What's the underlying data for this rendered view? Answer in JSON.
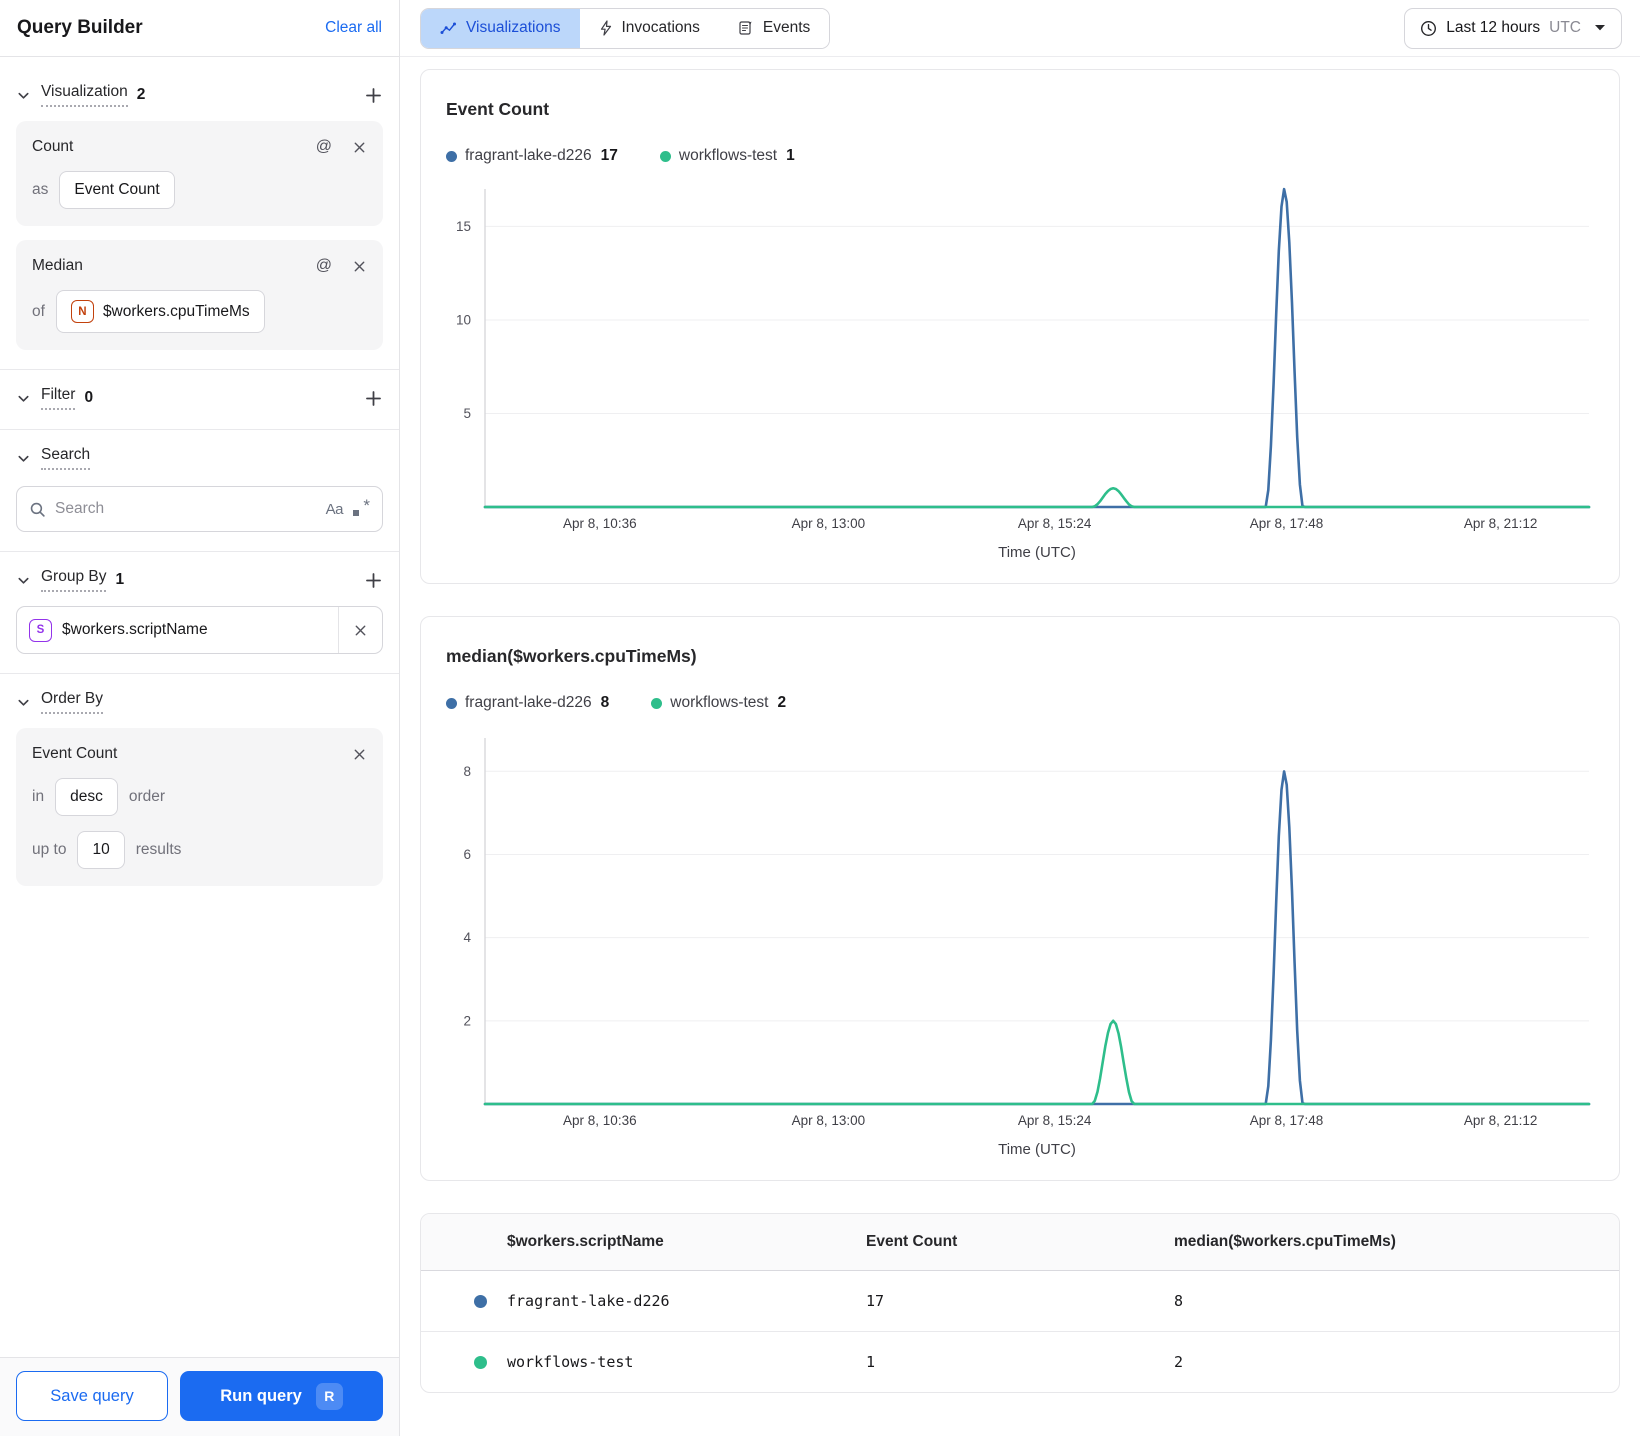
{
  "sidebar": {
    "title": "Query Builder",
    "clear_all": "Clear all",
    "visualization": {
      "label": "Visualization",
      "count": "2",
      "cards": [
        {
          "title": "Count",
          "prefix": "as",
          "value": "Event Count"
        },
        {
          "title": "Median",
          "prefix": "of",
          "field_icon_letter": "N",
          "value": "$workers.cpuTimeMs"
        }
      ]
    },
    "filter": {
      "label": "Filter",
      "count": "0"
    },
    "search": {
      "label": "Search",
      "placeholder": "Search",
      "case_toggle": "Aa"
    },
    "group_by": {
      "label": "Group By",
      "count": "1",
      "item": {
        "icon_letter": "S",
        "value": "$workers.scriptName"
      }
    },
    "order_by": {
      "label": "Order By",
      "card": {
        "title": "Event Count",
        "in_label": "in",
        "direction": "desc",
        "order_label": "order",
        "upto_label": "up to",
        "limit": "10",
        "results_label": "results"
      }
    },
    "footer": {
      "save_label": "Save query",
      "run_label": "Run query",
      "run_shortcut": "R"
    }
  },
  "topbar": {
    "tabs": [
      {
        "label": "Visualizations",
        "active": true
      },
      {
        "label": "Invocations",
        "active": false
      },
      {
        "label": "Events",
        "active": false
      }
    ],
    "time_range": {
      "label": "Last 12 hours",
      "timezone": "UTC"
    }
  },
  "chart_data": [
    {
      "type": "line",
      "title": "Event Count",
      "xlabel": "Time (UTC)",
      "ylim": [
        0,
        17
      ],
      "yticks": [
        5,
        10,
        15
      ],
      "grid": true,
      "legend_position": "top",
      "xticks": [
        {
          "label": "Apr 8, 10:36",
          "f": 0.104
        },
        {
          "label": "Apr 8, 13:00",
          "f": 0.311
        },
        {
          "label": "Apr 8, 15:24",
          "f": 0.516
        },
        {
          "label": "Apr 8, 17:48",
          "f": 0.726
        },
        {
          "label": "Apr 8, 21:12",
          "f": 0.92
        }
      ],
      "series": [
        {
          "name": "fragrant-lake-d226",
          "color": "#3E6FA6",
          "legend_value": "17",
          "baseline": 0,
          "peaks": [
            {
              "f": 0.724,
              "half_width": 0.017,
              "value": 17,
              "time_approx": "Apr 8, 17:45"
            }
          ]
        },
        {
          "name": "workflows-test",
          "color": "#2EBE8B",
          "legend_value": "1",
          "baseline": 0,
          "peaks": [
            {
              "f": 0.569,
              "half_width": 0.019,
              "value": 1,
              "time_approx": "Apr 8, 16:00"
            }
          ]
        }
      ]
    },
    {
      "type": "line",
      "title": "median($workers.cpuTimeMs)",
      "xlabel": "Time (UTC)",
      "ylim": [
        0,
        8.8
      ],
      "yticks": [
        2,
        4,
        6,
        8
      ],
      "grid": true,
      "legend_position": "top",
      "xticks": [
        {
          "label": "Apr 8, 10:36",
          "f": 0.104
        },
        {
          "label": "Apr 8, 13:00",
          "f": 0.311
        },
        {
          "label": "Apr 8, 15:24",
          "f": 0.516
        },
        {
          "label": "Apr 8, 17:48",
          "f": 0.726
        },
        {
          "label": "Apr 8, 21:12",
          "f": 0.92
        }
      ],
      "series": [
        {
          "name": "fragrant-lake-d226",
          "color": "#3E6FA6",
          "legend_value": "8",
          "baseline": 0,
          "peaks": [
            {
              "f": 0.724,
              "half_width": 0.017,
              "value": 8,
              "time_approx": "Apr 8, 17:45"
            }
          ]
        },
        {
          "name": "workflows-test",
          "color": "#2EBE8B",
          "legend_value": "2",
          "baseline": 0,
          "peaks": [
            {
              "f": 0.569,
              "half_width": 0.019,
              "value": 2,
              "time_approx": "Apr 8, 16:00"
            }
          ]
        }
      ]
    }
  ],
  "table": {
    "columns": [
      "$workers.scriptName",
      "Event Count",
      "median($workers.cpuTimeMs)"
    ],
    "rows": [
      {
        "color": "#3E6FA6",
        "name": "fragrant-lake-d226",
        "event_count": "17",
        "median": "8"
      },
      {
        "color": "#2EBE8B",
        "name": "workflows-test",
        "event_count": "1",
        "median": "2"
      }
    ]
  }
}
